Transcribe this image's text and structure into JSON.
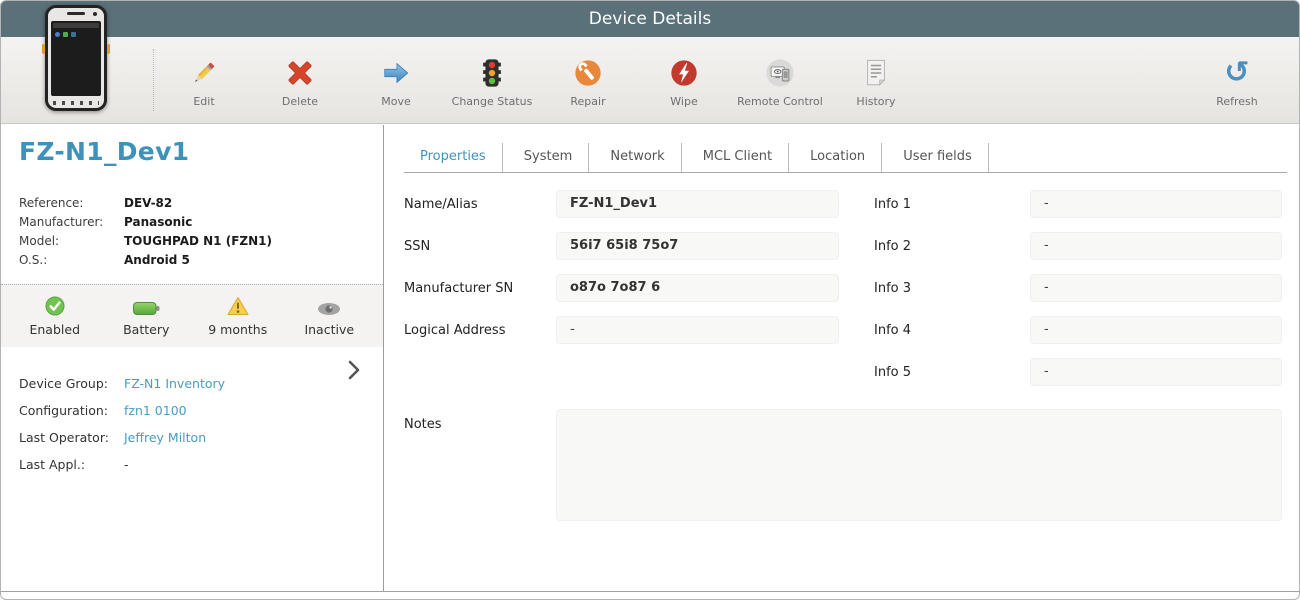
{
  "header": {
    "title": "Device Details"
  },
  "toolbar": {
    "items": [
      {
        "label": "Edit",
        "icon": "pencil-icon"
      },
      {
        "label": "Delete",
        "icon": "red-x-icon"
      },
      {
        "label": "Move",
        "icon": "blue-arrow-icon"
      },
      {
        "label": "Change Status",
        "icon": "traffic-light-icon"
      },
      {
        "label": "Repair",
        "icon": "wrench-icon"
      },
      {
        "label": "Wipe",
        "icon": "lightning-icon"
      },
      {
        "label": "Remote Control",
        "icon": "monitor-phone-icon"
      },
      {
        "label": "History",
        "icon": "document-icon"
      }
    ],
    "refresh_label": "Refresh",
    "refresh_glyph": "↺"
  },
  "device": {
    "name": "FZ-N1_Dev1",
    "details": [
      {
        "label": "Reference:",
        "value": "DEV-82"
      },
      {
        "label": "Manufacturer:",
        "value": "Panasonic"
      },
      {
        "label": "Model:",
        "value": "TOUGHPAD N1 (FZN1)"
      },
      {
        "label": "O.S.:",
        "value": "Android 5"
      }
    ],
    "statuses": [
      {
        "label": "Enabled",
        "icon": "check-circle-icon"
      },
      {
        "label": "Battery",
        "icon": "battery-icon"
      },
      {
        "label": "9 months",
        "icon": "warning-triangle-icon"
      },
      {
        "label": "Inactive",
        "icon": "eye-icon"
      }
    ],
    "fields": [
      {
        "label": "Device Group:",
        "value": "FZ-N1 Inventory"
      },
      {
        "label": "Configuration:",
        "value": "fzn1 0100"
      },
      {
        "label": "Last Operator:",
        "value": "Jeffrey Milton"
      },
      {
        "label": "Last Appl.:",
        "value": "-"
      }
    ]
  },
  "tabs": {
    "active": "Properties",
    "items": [
      {
        "label": "Properties"
      },
      {
        "label": "System"
      },
      {
        "label": "Network"
      },
      {
        "label": "MCL Client"
      },
      {
        "label": "Location"
      },
      {
        "label": "User fields"
      }
    ]
  },
  "form": {
    "left": [
      {
        "label": "Name/Alias",
        "value": "FZ-N1_Dev1"
      },
      {
        "label": "SSN",
        "value": "56i7 65i8 75o7"
      },
      {
        "label": "Manufacturer SN",
        "value": "o87o 7o87 6"
      },
      {
        "label": "Logical Address",
        "value": "-"
      }
    ],
    "right": [
      {
        "label": "Info 1",
        "value": "-"
      },
      {
        "label": "Info 2",
        "value": "-"
      },
      {
        "label": "Info 3",
        "value": "-"
      },
      {
        "label": "Info 4",
        "value": "-"
      },
      {
        "label": "Info 5",
        "value": "-"
      }
    ],
    "notes": {
      "label": "Notes",
      "value": ""
    }
  },
  "colors": {
    "header_bg": "#5a7179",
    "title_blue": "#3e92ba",
    "link_blue": "#4a9cc0",
    "tab_active_blue": "#4293b8",
    "field_bg": "#f8f8f6",
    "status_strip_bg": "#f4f3f1"
  }
}
